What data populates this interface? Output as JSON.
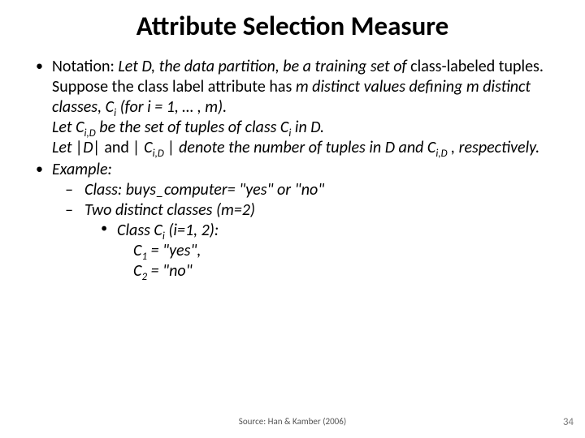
{
  "title": "Attribute Selection Measure",
  "bullets": {
    "notation_label": "Notation: ",
    "notation_line1a": "Let D, the data partition, be a training set of ",
    "notation_line1b": "class-labeled tuples.",
    "notation_line2a": "Suppose the class label attribute has ",
    "notation_line2b": "m distinct values defining m distinct classes, C",
    "notation_line2c": " (for i = 1, … , m).",
    "notation_sub_i": "i",
    "notation_line3a": "Let C",
    "notation_line3b": " be the set of tuples of class C",
    "notation_line3c": " in D.",
    "notation_sub_iD": "i,D",
    "notation_line4a": "Let |D| ",
    "notation_line4b": "and ",
    "notation_line4c": "| C",
    "notation_line4d": " | denote the number of tuples in D and C",
    "notation_line4e": " , respectively.",
    "example_label": "Example:",
    "dash1": "Class: buys_computer= \"yes\" or \"no\"",
    "dash2": "Two distinct classes (m=2)",
    "inner_a": "Class C",
    "inner_b": " (i=1, 2):",
    "c1_line": "C",
    "c1_sub": "1",
    "c1_rest": " = \"yes\",",
    "c2_line": "C",
    "c2_sub": "2",
    "c2_rest": " = \"no\""
  },
  "source": "Source: Han & Kamber (2006)",
  "pagenum": "34"
}
